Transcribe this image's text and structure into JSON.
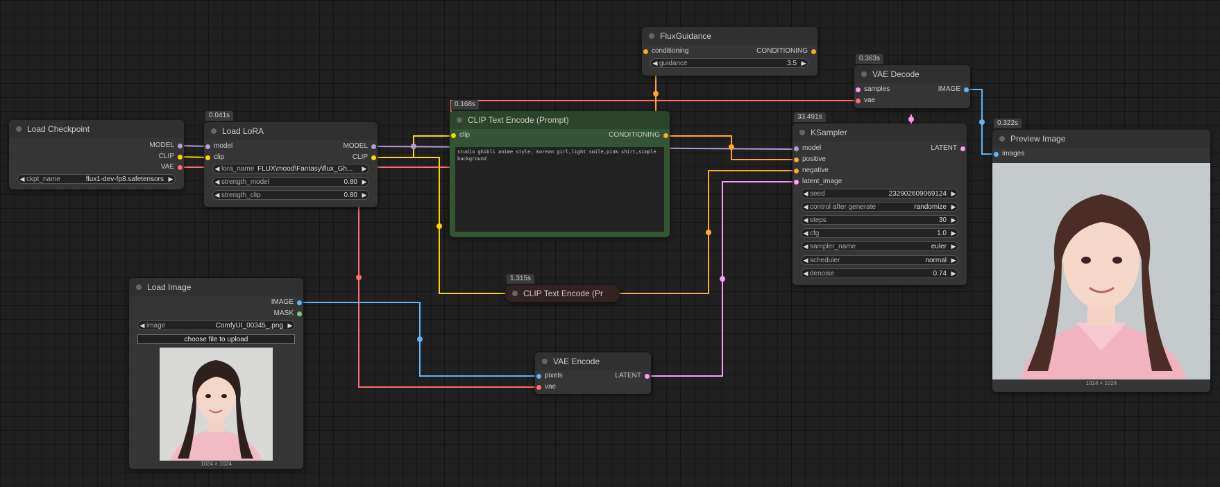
{
  "colors": {
    "model": "#b39ddb",
    "clip": "#ffd500",
    "vae": "#ff6e6e",
    "conditioning": "#ffa931",
    "latent": "#ff9cf9",
    "image": "#64b5f6",
    "mask": "#81c784"
  },
  "nodes": {
    "load_checkpoint": {
      "title": "Load Checkpoint",
      "outputs": [
        "MODEL",
        "CLIP",
        "VAE"
      ],
      "widgets": [
        {
          "label": "ckpt_name",
          "value": "flux1-dev-fp8.safetensors"
        }
      ]
    },
    "load_lora": {
      "badge": "0.041s",
      "title": "Load LoRA",
      "inputs": [
        "model",
        "clip"
      ],
      "outputs": [
        "MODEL",
        "CLIP"
      ],
      "widgets": [
        {
          "label": "lora_name",
          "value": "FLUX\\mood\\Fantasy\\flux_Gh..."
        },
        {
          "label": "strength_model",
          "value": "0.80"
        },
        {
          "label": "strength_clip",
          "value": "0.80"
        }
      ]
    },
    "clip_text_encode": {
      "badge": "0.168s",
      "title": "CLIP Text Encode (Prompt)",
      "inputs": [
        "clip"
      ],
      "outputs": [
        "CONDITIONING"
      ],
      "text": "studio ghibli anime style, korean girl,light smile,pink shirt,simple background"
    },
    "flux_guidance": {
      "title": "FluxGuidance",
      "inputs": [
        "conditioning"
      ],
      "outputs": [
        "CONDITIONING"
      ],
      "widgets": [
        {
          "label": "guidance",
          "value": "3.5"
        }
      ]
    },
    "vae_decode": {
      "badge": "0.363s",
      "title": "VAE Decode",
      "inputs": [
        "samples",
        "vae"
      ],
      "outputs": [
        "IMAGE"
      ]
    },
    "ksampler": {
      "badge": "33.491s",
      "title": "KSampler",
      "inputs": [
        "model",
        "positive",
        "negative",
        "latent_image"
      ],
      "outputs": [
        "LATENT"
      ],
      "widgets": [
        {
          "label": "seed",
          "value": "232902609069124"
        },
        {
          "label": "control after generate",
          "value": "randomize"
        },
        {
          "label": "steps",
          "value": "30"
        },
        {
          "label": "cfg",
          "value": "1.0"
        },
        {
          "label": "sampler_name",
          "value": "euler"
        },
        {
          "label": "scheduler",
          "value": "normal"
        },
        {
          "label": "denoise",
          "value": "0.74"
        }
      ]
    },
    "preview_image": {
      "badge": "0.322s",
      "title": "Preview Image",
      "inputs": [
        "images"
      ],
      "caption": "1024 × 1024"
    },
    "load_image": {
      "title": "Load Image",
      "outputs": [
        "IMAGE",
        "MASK"
      ],
      "widgets": [
        {
          "label": "image",
          "value": "ComfyUI_00345_.png"
        }
      ],
      "upload_label": "choose file to upload",
      "caption": "1024 × 1024"
    },
    "clip_text_encode_collapsed": {
      "badge": "1.315s",
      "title": "CLIP Text Encode (Pr"
    },
    "vae_encode": {
      "title": "VAE Encode",
      "inputs": [
        "pixels",
        "vae"
      ],
      "outputs": [
        "LATENT"
      ]
    }
  },
  "icons": {
    "arrow_left": "◀",
    "arrow_right": "▶"
  }
}
